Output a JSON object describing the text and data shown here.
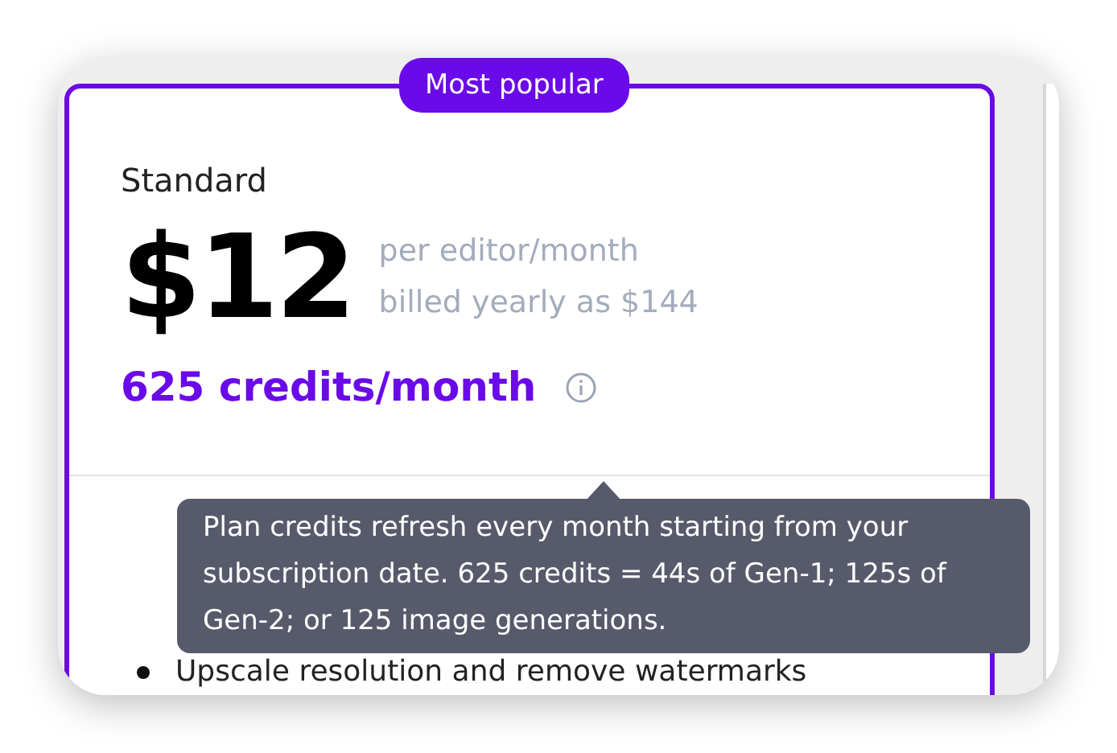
{
  "badge": "Most popular",
  "plan": {
    "name": "Standard",
    "price": "$12",
    "price_note": "per editor/month",
    "billing": "billed yearly as $144",
    "credits": "625 credits/month"
  },
  "tooltip": {
    "text": "Plan credits refresh every month starting from your subscription date. 625 credits = 44s of Gen-1; 125s of Gen-2; or 125 image generations."
  },
  "features": [
    "Upscale resolution and remove watermarks"
  ]
}
